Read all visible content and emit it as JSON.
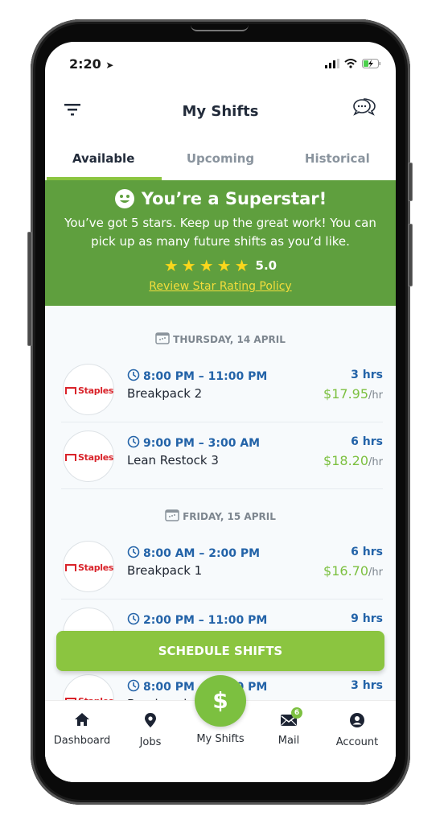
{
  "status_bar": {
    "time": "2:20"
  },
  "header": {
    "title": "My Shifts"
  },
  "tabs": [
    {
      "label": "Available",
      "active": true
    },
    {
      "label": "Upcoming",
      "active": false
    },
    {
      "label": "Historical",
      "active": false
    }
  ],
  "banner": {
    "title": "You’re a Superstar!",
    "text": "You’ve got 5 stars. Keep up the great work! You can pick up as many future shifts as you’d like.",
    "stars": 5,
    "rating": "5.0",
    "link": "Review Star Rating Policy",
    "color": "#5f9f3e"
  },
  "groups": [
    {
      "date": "THURSDAY, 14 APRIL"
    },
    {
      "date": "FRIDAY, 15 APRIL"
    }
  ],
  "shifts": [
    {
      "employer": "Staples",
      "time": "8:00 PM – 11:00 PM",
      "name": "Breakpack 2",
      "hours": "3 hrs",
      "pay": "$17.95",
      "unit": "/hr"
    },
    {
      "employer": "Staples",
      "time": "9:00 PM – 3:00 AM",
      "name": "Lean Restock 3",
      "hours": "6 hrs",
      "pay": "$18.20",
      "unit": "/hr"
    },
    {
      "employer": "Staples",
      "time": "8:00 AM – 2:00 PM",
      "name": "Breakpack 1",
      "hours": "6 hrs",
      "pay": "$16.70",
      "unit": "/hr"
    },
    {
      "employer": "Staples",
      "time": "2:00 PM – 11:00 PM",
      "name": "",
      "hours": "9 hrs",
      "pay": "",
      "unit": ""
    },
    {
      "employer": "Staples",
      "time": "8:00 PM – 11:00 PM",
      "name": "Breakpack",
      "hours": "3 hrs",
      "pay": "",
      "unit": ""
    }
  ],
  "schedule_button": "SCHEDULE SHIFTS",
  "nav": {
    "fab_symbol": "$",
    "items": [
      {
        "label": "Dashboard",
        "icon": "home-icon"
      },
      {
        "label": "Jobs",
        "icon": "map-pin-icon"
      },
      {
        "label": "My Shifts",
        "icon": "dollar-icon"
      },
      {
        "label": "Mail",
        "icon": "mail-icon",
        "badge": "6"
      },
      {
        "label": "Account",
        "icon": "user-circle-icon"
      }
    ]
  },
  "colors": {
    "accent": "#8bc540",
    "time_blue": "#2363a8",
    "pay_green": "#7cc040",
    "brand_red": "#d9232a"
  }
}
